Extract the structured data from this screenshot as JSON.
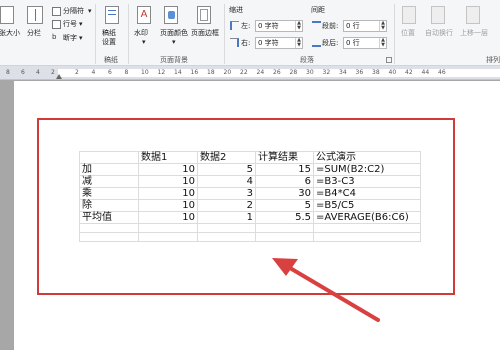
{
  "ribbon": {
    "left_group": {
      "item1": "纸张大小",
      "item2": "分栏",
      "item3": "分隔符",
      "item4": "行号",
      "item5": "断字"
    },
    "manuscript": {
      "button": "稿纸设置",
      "group": "稿纸"
    },
    "page_background": {
      "watermark": "水印",
      "page_color": "页面颜色",
      "page_border": "页面边框",
      "group": "页面背景"
    },
    "paragraph": {
      "indent_title": "缩进",
      "spacing_title": "间距",
      "left_label": "左:",
      "right_label": "右:",
      "before_label": "段前:",
      "after_label": "段后:",
      "left_value": "0 字符",
      "right_value": "0 字符",
      "before_value": "0 行",
      "after_value": "0 行",
      "group": "段落"
    },
    "arrange": {
      "position": "位置",
      "wrap": "自动换行",
      "bring_forward": "上移一层",
      "group": "排列"
    }
  },
  "ruler": {
    "numbers": [
      "8",
      "6",
      "4",
      "2",
      "2",
      "4",
      "6",
      "8",
      "10",
      "12",
      "14",
      "16",
      "18",
      "20",
      "22",
      "24",
      "26",
      "28",
      "30",
      "32",
      "34",
      "36",
      "38",
      "40",
      "42",
      "44",
      "46"
    ]
  },
  "table": {
    "headers": [
      "",
      "数据1",
      "数据2",
      "计算结果",
      "公式演示"
    ],
    "rows": [
      [
        "加",
        "10",
        "5",
        "15",
        "=SUM(B2:C2)"
      ],
      [
        "减",
        "10",
        "4",
        "6",
        "=B3-C3"
      ],
      [
        "乘",
        "10",
        "3",
        "30",
        "=B4*C4"
      ],
      [
        "除",
        "10",
        "2",
        "5",
        "=B5/C5"
      ],
      [
        "平均值",
        "10",
        "1",
        "5.5",
        "=AVERAGE(B6:C6)"
      ]
    ]
  },
  "colors": {
    "highlight_border": "#d23a3a",
    "arrow": "#d94040",
    "ribbon_bg": "#f5f6f7",
    "app_bg": "#a7a7a7"
  }
}
